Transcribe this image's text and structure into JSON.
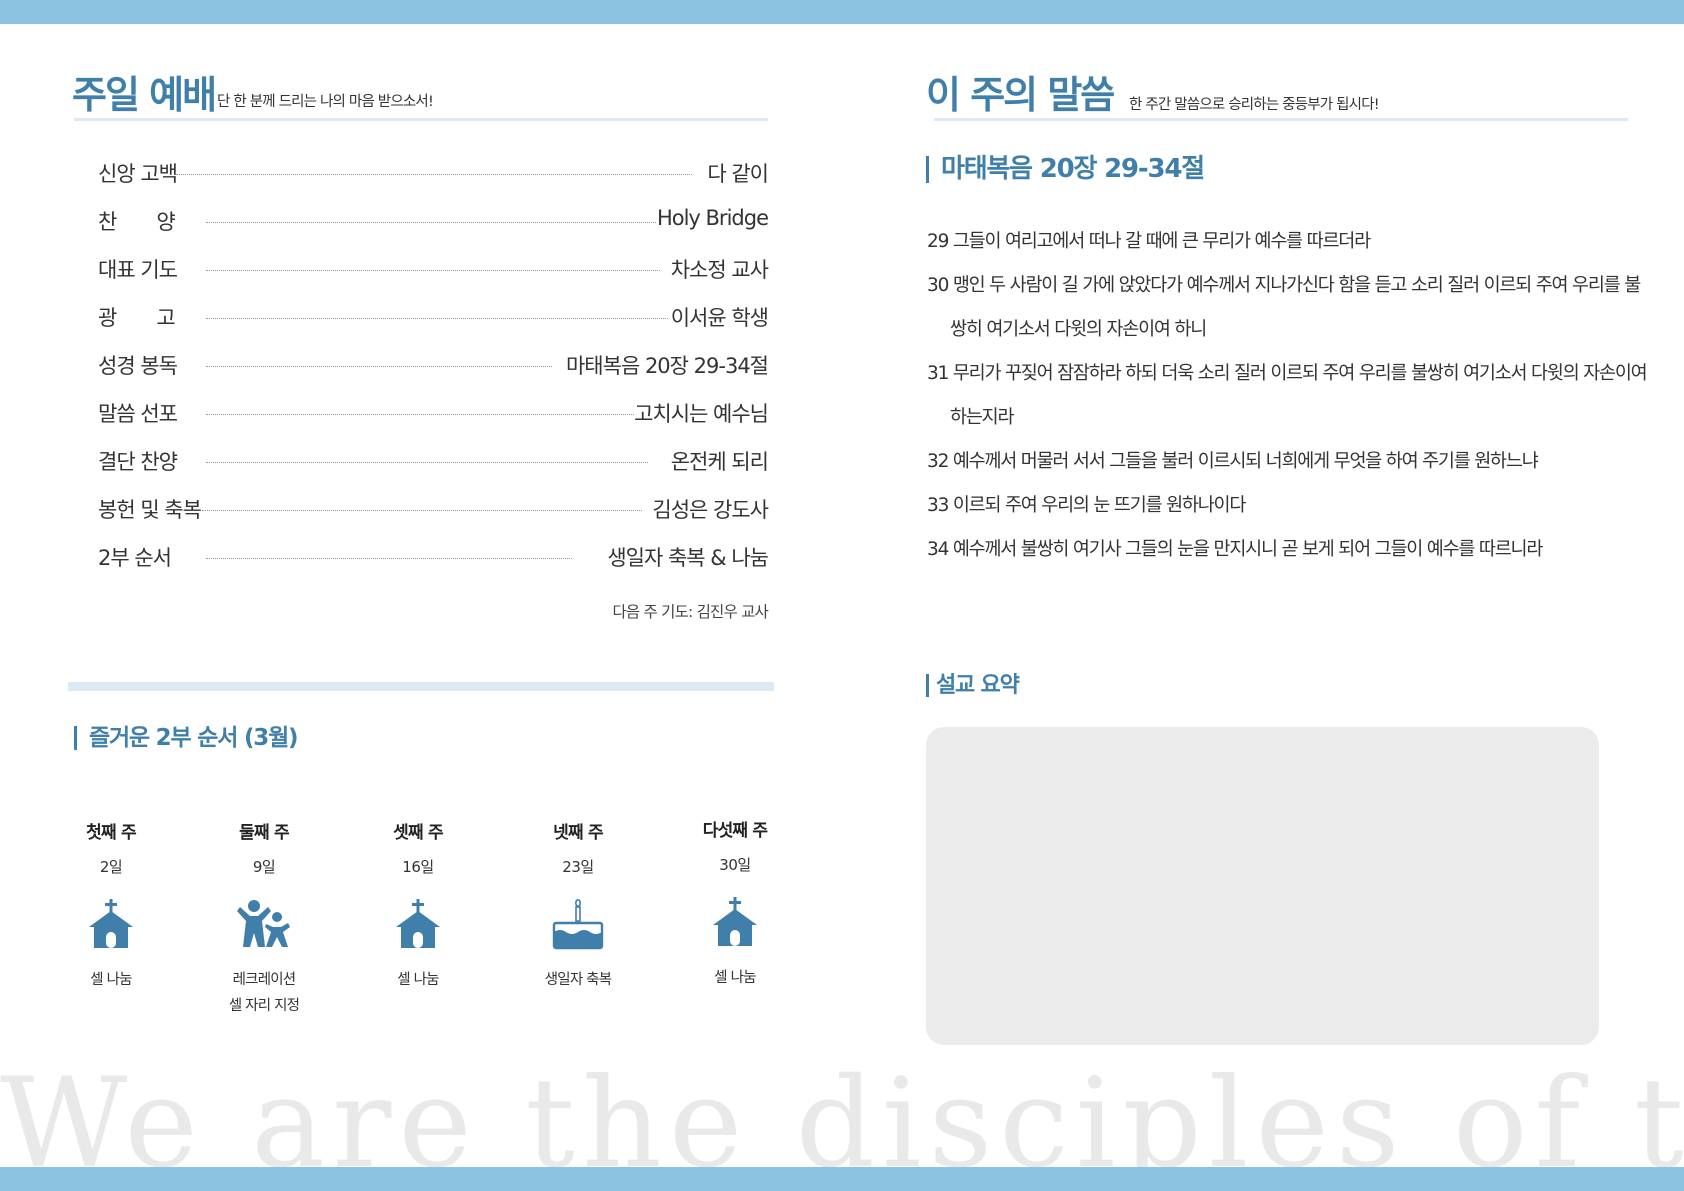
{
  "colors": {
    "accent": "#3f7fa9",
    "bar": "#8cc3e0",
    "rule": "#dbeaf5",
    "summary_box": "#ebebeb"
  },
  "worship": {
    "title": "주일 예배",
    "subtitle": "단 한 분께 드리는 나의 마음 받으소서!",
    "order": [
      {
        "label": "신앙 고백",
        "value": "다 같이"
      },
      {
        "label": "찬　　양",
        "value": "Holy Bridge"
      },
      {
        "label": "대표 기도",
        "value": "차소정 교사"
      },
      {
        "label": "광　　고",
        "value": "이서윤 학생"
      },
      {
        "label": "성경 봉독",
        "value": "마태복음 20장 29-34절"
      },
      {
        "label": "말씀 선포",
        "value": "고치시는 예수님"
      },
      {
        "label": "결단 찬양",
        "value": "온전케 되리"
      },
      {
        "label": "봉헌 및 축복",
        "value": "김성은 강도사"
      },
      {
        "label": "2부 순서",
        "value": "생일자 축복 & 나눔"
      }
    ],
    "next_prayer": "다음 주 기도: 김진우 교사"
  },
  "second_part": {
    "title": "즐거운 2부 순서 (3월)",
    "weeks": [
      {
        "name": "첫째 주",
        "date": "2일",
        "icon": "church-icon",
        "activity": "셀 나눔"
      },
      {
        "name": "둘째 주",
        "date": "9일",
        "icon": "people-icon",
        "activity": "레크레이션\n셀 자리 지정"
      },
      {
        "name": "셋째 주",
        "date": "16일",
        "icon": "church-icon",
        "activity": "셀 나눔"
      },
      {
        "name": "넷째 주",
        "date": "23일",
        "icon": "birthday-cake-icon",
        "activity": "생일자 축복"
      },
      {
        "name": "다섯째 주",
        "date": "30일",
        "icon": "church-icon",
        "activity": "셀 나눔"
      }
    ]
  },
  "word": {
    "title": "이 주의 말씀",
    "subtitle": "한 주간 말씀으로 승리하는 중등부가 됩시다!",
    "passage": "마태복음 20장 29-34절",
    "verses": [
      "29 그들이 여리고에서 떠나 갈 때에 큰 무리가 예수를 따르더라",
      "30 맹인 두 사람이 길 가에 앉았다가 예수께서 지나가신다 함을 듣고 소리 질러 이르되 주여 우리를 불쌍히 여기소서 다윗의 자손이여 하니",
      "31 무리가 꾸짖어 잠잠하라 하되 더욱 소리 질러 이르되 주여 우리를 불쌍히 여기소서 다윗의 자손이여 하는지라",
      "32 예수께서 머물러 서서 그들을 불러 이르시되 너희에게 무엇을 하여 주기를 원하느냐",
      "33 이르되 주여 우리의 눈 뜨기를 원하나이다",
      "34 예수께서 불쌍히 여기사 그들의 눈을 만지시니 곧 보게 되어 그들이 예수를 따르니라"
    ]
  },
  "sermon_summary": {
    "title": "설교 요약"
  },
  "footer": {
    "motto": "We are the disciples of the Lord"
  }
}
